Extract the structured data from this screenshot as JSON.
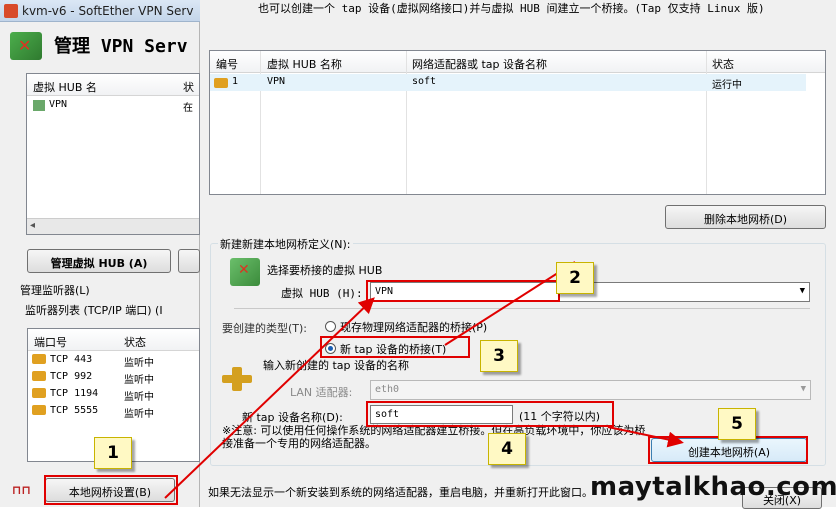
{
  "bg_window": {
    "title": "kvm-v6 - SoftEther VPN Serv",
    "header": "管理 VPN Serv",
    "hub_list": {
      "columns": [
        "虚拟 HUB 名",
        "状"
      ],
      "rows": [
        {
          "name": "VPN",
          "status": "在"
        }
      ]
    },
    "manage_hub_button": "管理虚拟 HUB (A)",
    "listener_group": "管理监听器(L)",
    "listener_list_label": "监听器列表 (TCP/IP 端口) (I",
    "listener_columns": [
      "端口号",
      "状态"
    ],
    "listeners": [
      {
        "port": "TCP 443",
        "status": "监听中"
      },
      {
        "port": "TCP 992",
        "status": "监听中"
      },
      {
        "port": "TCP 1194",
        "status": "监听中"
      },
      {
        "port": "TCP 5555",
        "status": "监听中"
      }
    ],
    "local_bridge_button": "本地网桥设置(B)"
  },
  "dialog": {
    "top_text": "也可以创建一个 tap 设备(虚拟网络接口)并与虚拟 HUB 间建立一个桥接。(Tap 仅支持 Linux 版)",
    "bridge_table": {
      "columns": [
        "编号",
        "虚拟 HUB 名称",
        "网络适配器或 tap 设备名称",
        "状态"
      ],
      "rows": [
        {
          "id": "1",
          "hub": "VPN",
          "adapter": "soft",
          "status": "运行中"
        }
      ]
    },
    "delete_button": "删除本地网桥(D)",
    "new_group_label": "新建新建本地网桥定义(N):",
    "select_hub_label": "选择要桥接的虚拟 HUB",
    "hub_field_label": "虚拟 HUB (H):",
    "hub_value": "VPN",
    "type_label": "要创建的类型(T):",
    "radio_physical": "现存物理网络适配器的桥接(P)",
    "radio_tap": "新 tap 设备的桥接(T)",
    "radio_selected": "tap",
    "tap_hint": "输入新创建的 tap 设备的名称",
    "lan_label": "LAN 适配器:",
    "lan_value": "eth0",
    "tap_name_label": "新 tap 设备名称(D):",
    "tap_name_value": "soft",
    "tap_name_hint": "(11 个字符以内)",
    "note": "※注意: 可以使用任何操作系统的网络适配器建立桥接。但在高负载环境中，你应该为桥接准备一个专用的网络适配器。",
    "create_button": "创建本地网桥(A)",
    "bottom_text": "如果无法显示一个新安装到系统的网络适配器，重启电脑，并重新打开此窗口。",
    "close_button": "关闭(X)"
  },
  "callouts": [
    "1",
    "2",
    "3",
    "4",
    "5"
  ],
  "watermark": "maytalkhao.com",
  "colors": {
    "highlight": "#e00000",
    "callout_bg": "#fff9c4"
  }
}
